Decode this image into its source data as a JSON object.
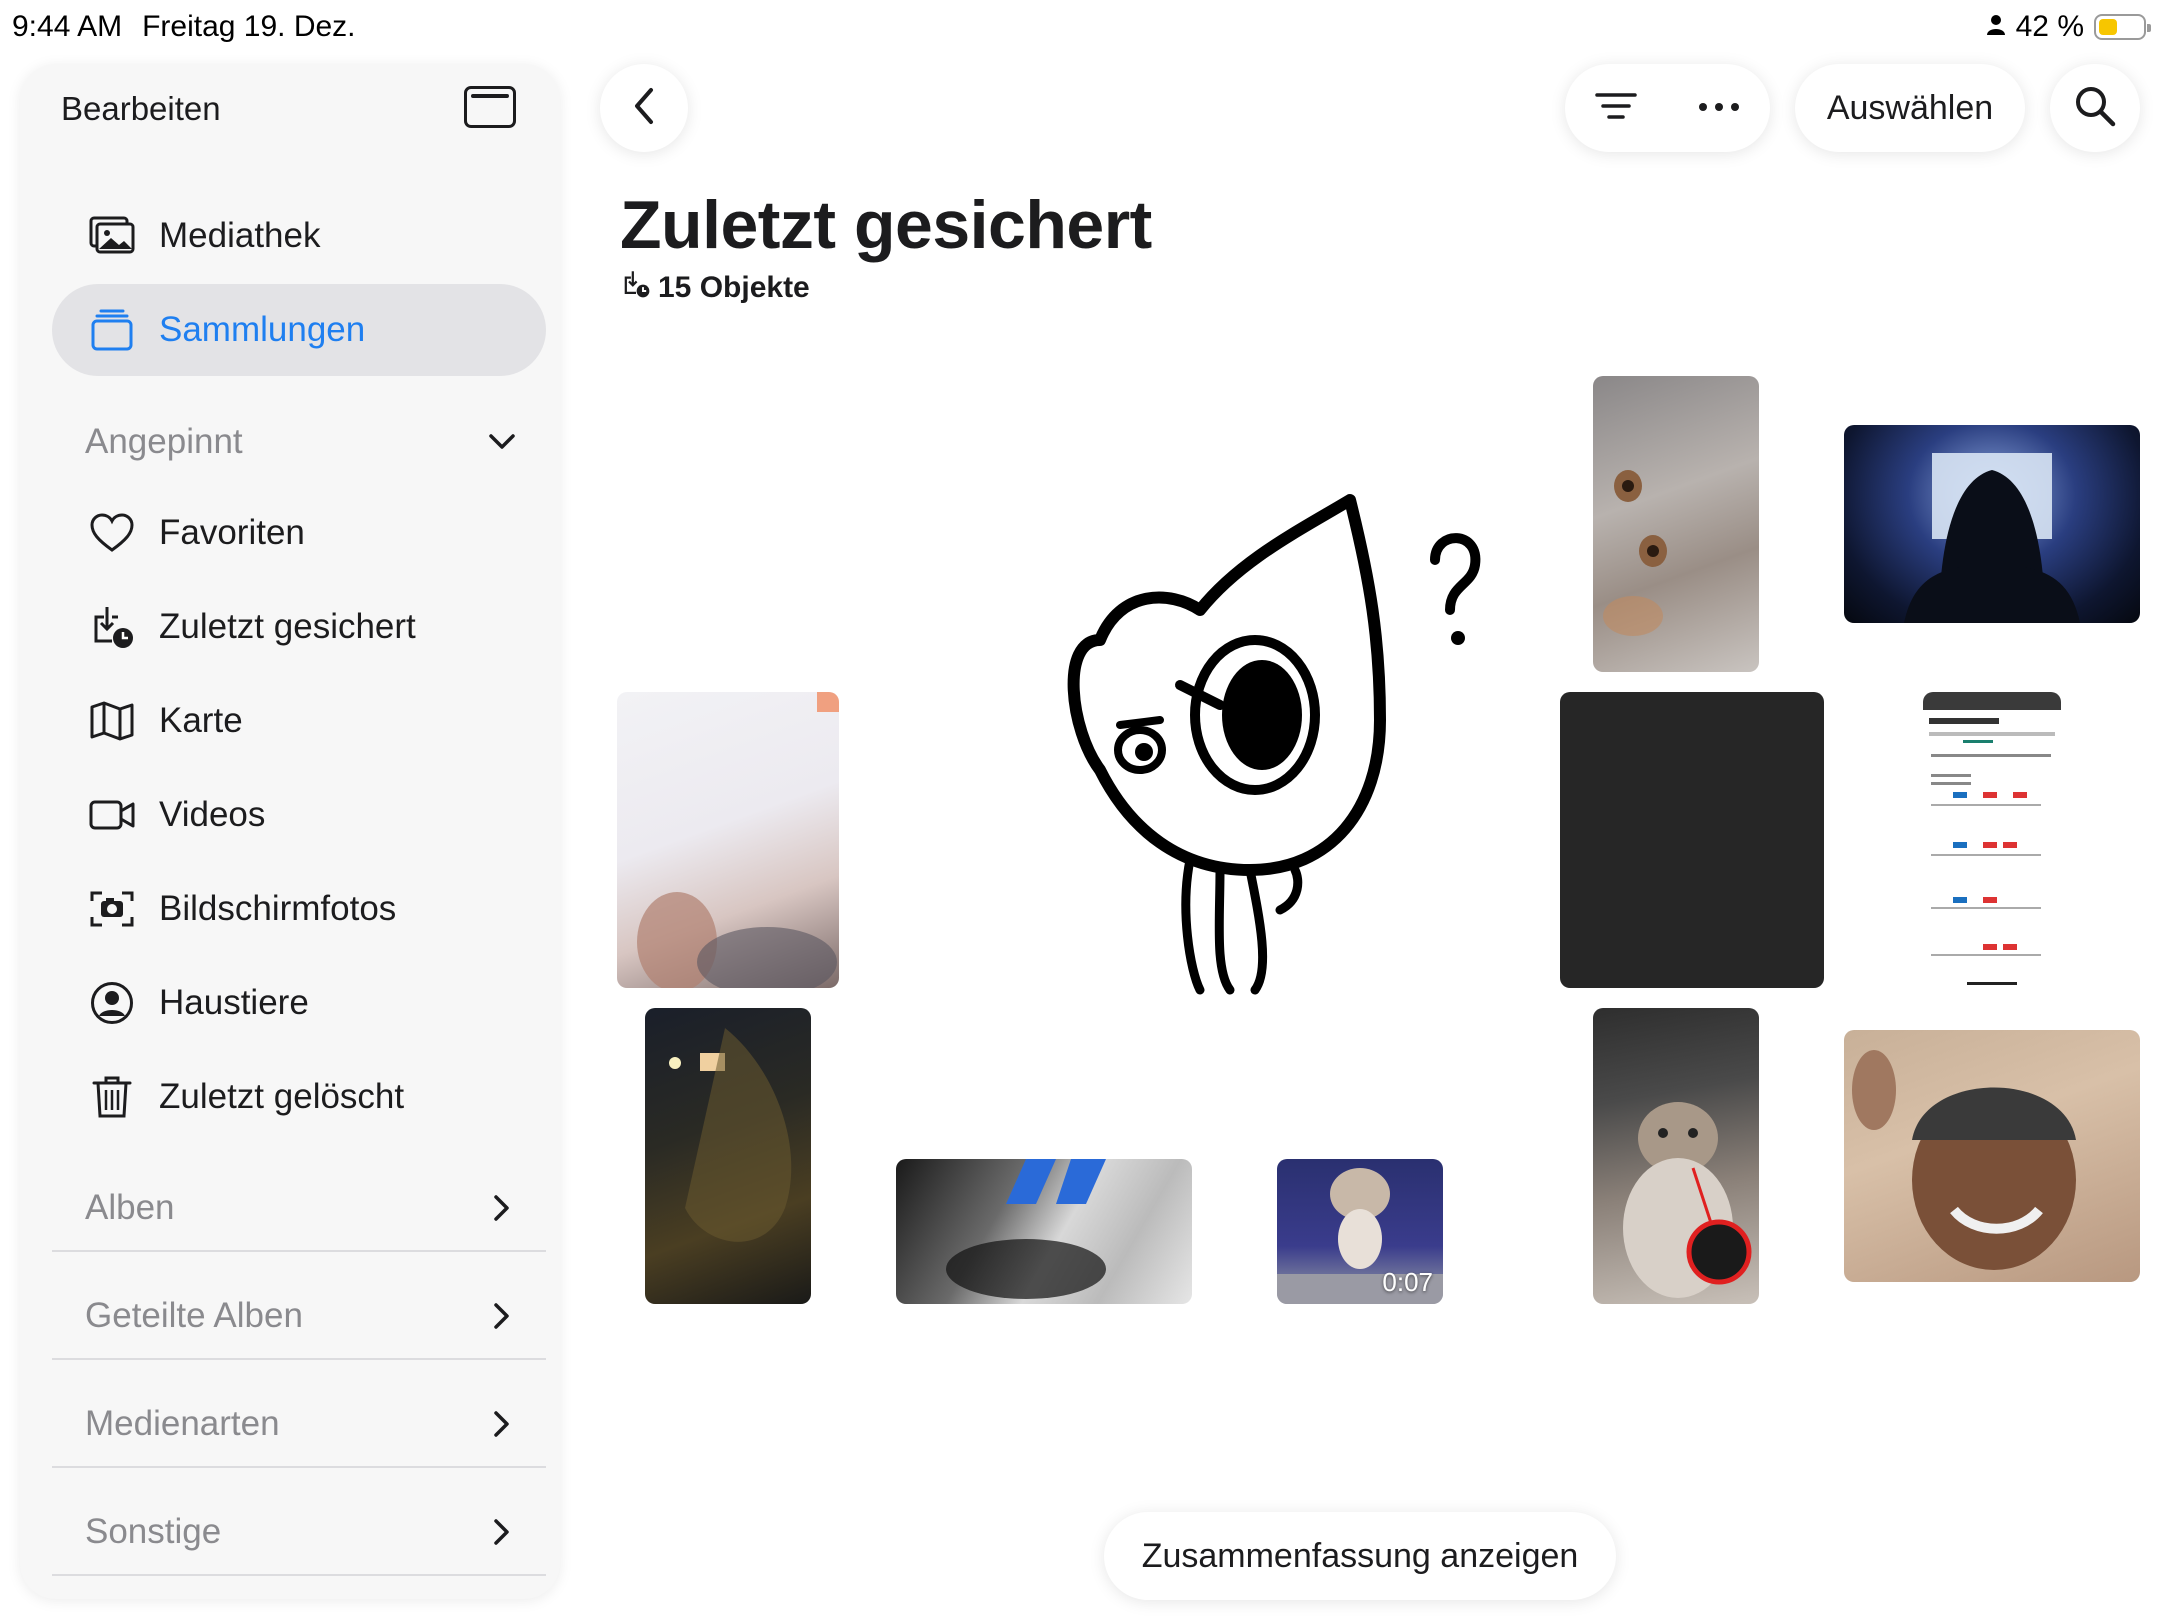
{
  "status_bar": {
    "time": "9:44 AM",
    "date": "Freitag 19. Dez.",
    "battery_text": "42 %",
    "battery_level": 0.42,
    "battery_color": "#f7c600"
  },
  "sidebar": {
    "edit_label": "Bearbeiten",
    "toggle_icon": "sidebar-toggle-icon",
    "items": [
      {
        "label": "Mediathek",
        "icon": "photo-library-icon"
      },
      {
        "label": "Sammlungen",
        "icon": "collections-icon",
        "active": true
      },
      {
        "label": "Favoriten",
        "icon": "heart-icon"
      },
      {
        "label": "Zuletzt gesichert",
        "icon": "recently-saved-icon"
      },
      {
        "label": "Karte",
        "icon": "map-icon"
      },
      {
        "label": "Videos",
        "icon": "video-icon"
      },
      {
        "label": "Bildschirmfotos",
        "icon": "screenshot-icon"
      },
      {
        "label": "Haustiere",
        "icon": "person-circle-icon"
      },
      {
        "label": "Zuletzt gelöscht",
        "icon": "trash-icon"
      }
    ],
    "pinned_header": "Angepinnt",
    "sections": [
      {
        "label": "Alben"
      },
      {
        "label": "Geteilte Alben"
      },
      {
        "label": "Medienarten"
      },
      {
        "label": "Sonstige"
      }
    ],
    "accent_color": "#1f7ff0"
  },
  "toolbar": {
    "back_icon": "chevron-left-icon",
    "filter_icon": "filter-icon",
    "more_icon": "more-icon",
    "select_label": "Auswählen",
    "search_icon": "search-icon"
  },
  "main": {
    "title": "Zuletzt gesichert",
    "count_label": "15 Objekte",
    "video_duration": "0:07",
    "summary_button": "Zusammenfassung anzeigen"
  }
}
